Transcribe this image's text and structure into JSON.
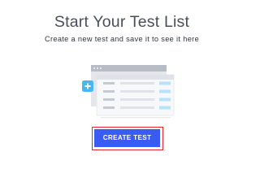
{
  "empty_state": {
    "title": "Start Your Test List",
    "subtitle": "Create a new test and save it to see it here",
    "create_button_label": "CREATE TEST"
  },
  "colors": {
    "title_text": "#4a4f57",
    "button_bg": "#3a5bf4",
    "button_highlight": "#e3262f",
    "plus_badge": "#47b7f2"
  },
  "icons": {
    "illustration": "test-list-illustration",
    "plus": "plus-icon"
  }
}
